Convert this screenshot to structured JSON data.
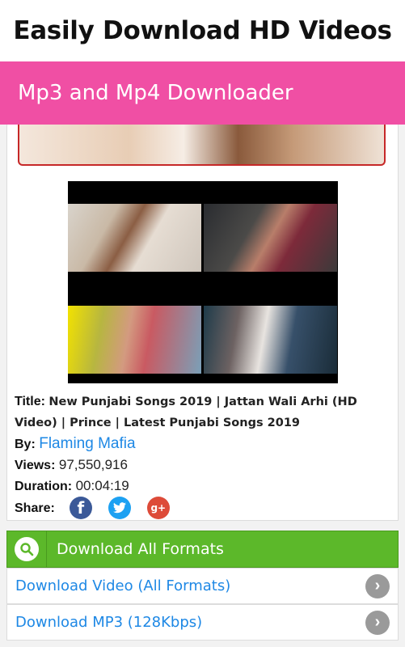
{
  "banner": {
    "title": "Easily Download HD Videos"
  },
  "appbar": {
    "title": "Mp3 and Mp4 Downloader"
  },
  "video": {
    "title_label": "Title:",
    "title": "New Punjabi Songs 2019 | Jattan Wali Arhi (HD Video) | Prince | Latest Punjabi Songs 2019",
    "by_label": "By:",
    "author": "Flaming Mafia",
    "views_label": "Views:",
    "views": "97,550,916",
    "duration_label": "Duration:",
    "duration": "00:04:19",
    "share_label": "Share:",
    "share_icons": [
      "facebook-icon",
      "twitter-icon",
      "google-plus-icon"
    ]
  },
  "downloads": {
    "header": "Download All Formats",
    "items": [
      {
        "label": "Download Video (All Formats)"
      },
      {
        "label": "Download MP3 (128Kbps)"
      }
    ]
  },
  "colors": {
    "appbar": "#f04fa4",
    "download_header": "#5cb82a",
    "link": "#1e88e5"
  }
}
